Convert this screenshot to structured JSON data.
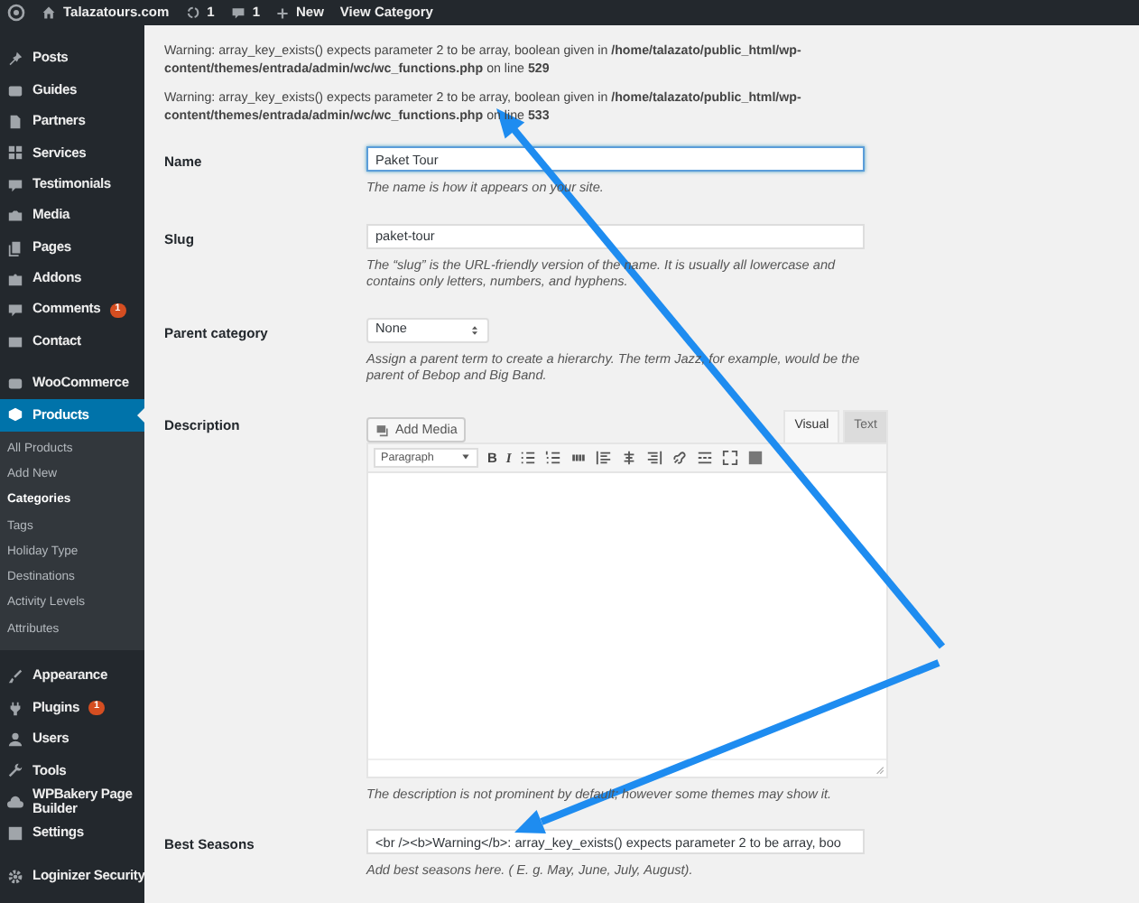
{
  "admin_bar": {
    "site": "Talazatours.com",
    "updates": "1",
    "comments": "1",
    "new": "New",
    "view": "View Category"
  },
  "sidebar": {
    "groups": [
      [
        {
          "label": "Posts",
          "selected": false
        },
        {
          "label": "Guides",
          "selected": false
        },
        {
          "label": "Partners",
          "selected": false
        },
        {
          "label": "Services",
          "selected": false
        },
        {
          "label": "Testimonials",
          "selected": false
        },
        {
          "label": "Media",
          "selected": false
        },
        {
          "label": "Pages",
          "selected": false
        },
        {
          "label": "Addons",
          "selected": false
        },
        {
          "label": "Comments",
          "badge": "1",
          "selected": false
        },
        {
          "label": "Contact",
          "selected": false
        }
      ],
      [
        {
          "label": "WooCommerce",
          "selected": false
        },
        {
          "label": "Products",
          "selected": true,
          "submenu": [
            {
              "label": "All Products",
              "selected": false
            },
            {
              "label": "Add New",
              "selected": false
            },
            {
              "label": "Categories",
              "selected": true
            },
            {
              "label": "Tags",
              "selected": false
            },
            {
              "label": "Holiday Type",
              "selected": false
            },
            {
              "label": "Destinations",
              "selected": false
            },
            {
              "label": "Activity Levels",
              "selected": false
            },
            {
              "label": "Attributes",
              "selected": false
            }
          ]
        }
      ],
      [
        {
          "label": "Appearance",
          "selected": false
        },
        {
          "label": "Plugins",
          "badge": "1",
          "selected": false
        },
        {
          "label": "Users",
          "selected": false
        },
        {
          "label": "Tools",
          "selected": false
        },
        {
          "label": "WPBakery Page Builder",
          "selected": false
        },
        {
          "label": "Settings",
          "selected": false
        }
      ],
      [
        {
          "label": "Loginizer Security",
          "selected": false
        }
      ]
    ]
  },
  "warnings": [
    "Warning: array_key_exists() expects parameter 2 to be array, boolean given in **/home/talazato/public_html/wp-content/themes/entrada/admin/wc/wc_functions.php** on line **529**",
    "Warning: array_key_exists() expects parameter 2 to be array, boolean given in **/home/talazato/public_html/wp-content/themes/entrada/admin/wc/wc_functions.php** on line **533**"
  ],
  "fields": [
    {
      "kind": "text",
      "label": "Name",
      "value": "Paket Tour",
      "focused": true,
      "help": "The name is how it appears on your site."
    },
    {
      "kind": "text",
      "label": "Slug",
      "value": "paket-tour",
      "focused": false,
      "help": "The “slug” is the URL-friendly version of the name. It is usually all lowercase and contains only letters, numbers, and hyphens."
    },
    {
      "kind": "select",
      "label": "Parent category",
      "value": "None",
      "help": "Assign a parent term to create a hierarchy. The term Jazz, for example, would be the parent of Bebop and Big Band."
    },
    {
      "kind": "editor",
      "label": "Description",
      "add_media": "Add Media",
      "tabs": [
        {
          "label": "Visual",
          "selected": true
        },
        {
          "label": "Text",
          "selected": false
        }
      ],
      "format": "Paragraph",
      "bold": "B",
      "italic": "I",
      "help": "The description is not prominent by default; however some themes may show it."
    },
    {
      "kind": "text",
      "label": "Best Seasons",
      "value": "<br /><b>Warning</b>: array_key_exists() expects parameter 2 to be array, boo",
      "focused": false,
      "help": "Add best seasons here. ( E. g. May, June, July, August)."
    }
  ]
}
